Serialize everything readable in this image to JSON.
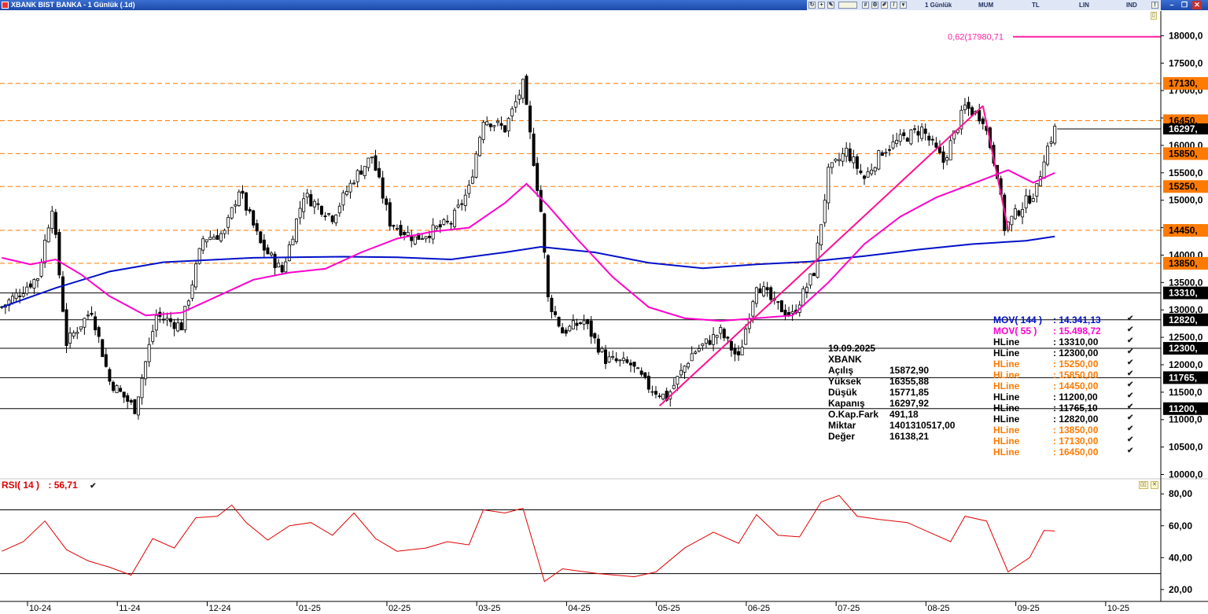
{
  "window": {
    "title": "XBANK BIST BANKA - 1 Günlük (.1d)",
    "toolbar": {
      "period": "1 Günlük",
      "chart_type": "MUM",
      "currency": "TL",
      "scale": "LIN",
      "indicator": "IND"
    }
  },
  "colors": {
    "orange": "#ff7a00",
    "magenta": "#ff00cc",
    "blue": "#0010c8",
    "rsi": "#e00000",
    "fib": "#ff1fa0",
    "trend": "#ff1090"
  },
  "price_axis": {
    "labels": [
      "18000,0",
      "17500,0",
      "17000,0",
      "16500,0",
      "16000,0",
      "15500,0",
      "15000,0",
      "14500,0",
      "14000,0",
      "13500,0",
      "13000,0",
      "12500,0",
      "12000,0",
      "11500,0",
      "11000,0",
      "10500,0",
      "10000,0"
    ],
    "values": [
      18000,
      17500,
      17000,
      16500,
      16000,
      15500,
      15000,
      14500,
      14000,
      13500,
      13000,
      12500,
      12000,
      11500,
      11000,
      10500,
      10000
    ],
    "ylim": [
      9950,
      18450
    ]
  },
  "hlines": [
    {
      "value": 17130,
      "label": "17130,",
      "style": "dashed",
      "color": "#ff7a00"
    },
    {
      "value": 16450,
      "label": "16450,",
      "style": "dashed",
      "color": "#ff7a00"
    },
    {
      "value": 15850,
      "label": "15850,",
      "style": "dashed",
      "color": "#ff7a00"
    },
    {
      "value": 15250,
      "label": "15250,",
      "style": "dashed",
      "color": "#ff7a00"
    },
    {
      "value": 14450,
      "label": "14450,",
      "style": "dashed",
      "color": "#ff7a00"
    },
    {
      "value": 13850,
      "label": "13850,",
      "style": "dashed",
      "color": "#ff7a00"
    },
    {
      "value": 13310,
      "label": "13310,",
      "style": "solid",
      "color": "#000000"
    },
    {
      "value": 12820,
      "label": "12820,",
      "style": "solid",
      "color": "#000000"
    },
    {
      "value": 12300,
      "label": "12300,",
      "style": "solid",
      "color": "#000000"
    },
    {
      "value": 11765,
      "label": "11765,",
      "style": "solid",
      "color": "#000000"
    },
    {
      "value": 11200,
      "label": "11200,",
      "style": "solid",
      "color": "#000000"
    }
  ],
  "current_price_label": "16297,",
  "fib": {
    "label": "0,62(17980,71",
    "value": 17980.71
  },
  "x_axis": {
    "labels": [
      "10-24",
      "11-24",
      "12-24",
      "01-25",
      "02-25",
      "03-25",
      "04-25",
      "05-25",
      "06-25",
      "07-25",
      "08-25",
      "09-25",
      "10-25"
    ],
    "index": [
      10,
      35,
      60,
      85,
      110,
      135,
      160,
      185,
      210,
      235,
      260,
      285,
      310
    ],
    "bars_total": 323
  },
  "info_panel": {
    "date": "19.09.2025",
    "symbol": "XBANK",
    "rows": [
      {
        "k": "Açılış",
        "v": "15872,90"
      },
      {
        "k": "Yüksek",
        "v": "16355,88"
      },
      {
        "k": "Düşük",
        "v": "15771,85"
      },
      {
        "k": "Kapanış",
        "v": "16297,92"
      },
      {
        "k": "O.Kap.Fark",
        "v": "491,18"
      },
      {
        "k": "Miktar",
        "v": "1401310517,00"
      },
      {
        "k": "Değer",
        "v": "16138,21"
      }
    ]
  },
  "legend": [
    {
      "name": "MOV( 144 )",
      "value": ": 14.341,13",
      "color": "#0010c8"
    },
    {
      "name": "MOV( 55 )",
      "value": ": 15.498,72",
      "color": "#ff00cc"
    },
    {
      "name": "HLine",
      "value": ": 13310,00",
      "color": "#000000"
    },
    {
      "name": "HLine",
      "value": ": 12300,00",
      "color": "#000000"
    },
    {
      "name": "HLine",
      "value": ": 15250,00",
      "color": "#ff7a00"
    },
    {
      "name": "HLine",
      "value": ": 15850,00",
      "color": "#ff7a00"
    },
    {
      "name": "HLine",
      "value": ": 14450,00",
      "color": "#ff7a00"
    },
    {
      "name": "HLine",
      "value": ": 11200,00",
      "color": "#000000"
    },
    {
      "name": "HLine",
      "value": ": 11765,10",
      "color": "#000000"
    },
    {
      "name": "HLine",
      "value": ": 12820,00",
      "color": "#000000"
    },
    {
      "name": "HLine",
      "value": ": 13850,00",
      "color": "#ff7a00"
    },
    {
      "name": "HLine",
      "value": ": 17130,00",
      "color": "#ff7a00"
    },
    {
      "name": "HLine",
      "value": ": 16450,00",
      "color": "#ff7a00"
    }
  ],
  "rsi": {
    "label": "RSI( 14 )",
    "value": ": 56,71",
    "axis_labels": [
      "80,00",
      "60,00",
      "40,00",
      "20,00"
    ],
    "axis_values": [
      80,
      60,
      40,
      20
    ],
    "levels": [
      70,
      30
    ],
    "ylim": [
      14,
      88
    ]
  },
  "chart_data": {
    "type": "candlestick",
    "symbol": "XBANK",
    "title": "XBANK BIST BANKA - 1 Günlük (.1d)",
    "ylim": [
      9950,
      18450
    ],
    "anchors": [
      {
        "i": 0,
        "p": 13050
      },
      {
        "i": 10,
        "p": 13600
      },
      {
        "i": 14,
        "p": 14900
      },
      {
        "i": 18,
        "p": 12400
      },
      {
        "i": 25,
        "p": 13000
      },
      {
        "i": 30,
        "p": 11700
      },
      {
        "i": 37,
        "p": 11200
      },
      {
        "i": 43,
        "p": 12900
      },
      {
        "i": 50,
        "p": 12700
      },
      {
        "i": 56,
        "p": 14300
      },
      {
        "i": 62,
        "p": 14400
      },
      {
        "i": 66,
        "p": 15200
      },
      {
        "i": 72,
        "p": 14200
      },
      {
        "i": 78,
        "p": 13700
      },
      {
        "i": 84,
        "p": 15100
      },
      {
        "i": 92,
        "p": 14700
      },
      {
        "i": 98,
        "p": 15400
      },
      {
        "i": 103,
        "p": 15800
      },
      {
        "i": 108,
        "p": 14600
      },
      {
        "i": 115,
        "p": 14300
      },
      {
        "i": 125,
        "p": 14600
      },
      {
        "i": 130,
        "p": 15200
      },
      {
        "i": 134,
        "p": 16500
      },
      {
        "i": 140,
        "p": 16300
      },
      {
        "i": 145,
        "p": 17100
      },
      {
        "i": 150,
        "p": 14800
      },
      {
        "i": 152,
        "p": 13200
      },
      {
        "i": 156,
        "p": 12600
      },
      {
        "i": 162,
        "p": 12800
      },
      {
        "i": 168,
        "p": 12100
      },
      {
        "i": 175,
        "p": 12000
      },
      {
        "i": 180,
        "p": 11600
      },
      {
        "i": 185,
        "p": 11400
      },
      {
        "i": 192,
        "p": 12200
      },
      {
        "i": 200,
        "p": 12600
      },
      {
        "i": 205,
        "p": 12100
      },
      {
        "i": 210,
        "p": 13500
      },
      {
        "i": 215,
        "p": 13100
      },
      {
        "i": 220,
        "p": 12900
      },
      {
        "i": 226,
        "p": 13700
      },
      {
        "i": 230,
        "p": 15500
      },
      {
        "i": 235,
        "p": 15900
      },
      {
        "i": 240,
        "p": 15400
      },
      {
        "i": 245,
        "p": 15900
      },
      {
        "i": 250,
        "p": 16100
      },
      {
        "i": 256,
        "p": 16300
      },
      {
        "i": 262,
        "p": 15700
      },
      {
        "i": 268,
        "p": 16700
      },
      {
        "i": 273,
        "p": 16500
      },
      {
        "i": 277,
        "p": 15500
      },
      {
        "i": 279,
        "p": 14500
      },
      {
        "i": 284,
        "p": 14900
      },
      {
        "i": 288,
        "p": 15200
      },
      {
        "i": 290,
        "p": 15800
      },
      {
        "i": 293,
        "p": 16300
      }
    ],
    "mov144": [
      {
        "i": 0,
        "p": 13050
      },
      {
        "i": 15,
        "p": 13400
      },
      {
        "i": 30,
        "p": 13700
      },
      {
        "i": 45,
        "p": 13870
      },
      {
        "i": 70,
        "p": 13950
      },
      {
        "i": 95,
        "p": 13970
      },
      {
        "i": 110,
        "p": 13960
      },
      {
        "i": 125,
        "p": 13920
      },
      {
        "i": 140,
        "p": 14050
      },
      {
        "i": 150,
        "p": 14150
      },
      {
        "i": 165,
        "p": 14050
      },
      {
        "i": 180,
        "p": 13860
      },
      {
        "i": 195,
        "p": 13760
      },
      {
        "i": 210,
        "p": 13830
      },
      {
        "i": 225,
        "p": 13880
      },
      {
        "i": 240,
        "p": 13980
      },
      {
        "i": 255,
        "p": 14100
      },
      {
        "i": 270,
        "p": 14200
      },
      {
        "i": 285,
        "p": 14260
      },
      {
        "i": 293,
        "p": 14341
      }
    ],
    "mov55": [
      {
        "i": 0,
        "p": 13950
      },
      {
        "i": 8,
        "p": 13830
      },
      {
        "i": 15,
        "p": 13920
      },
      {
        "i": 22,
        "p": 13650
      },
      {
        "i": 30,
        "p": 13250
      },
      {
        "i": 40,
        "p": 12900
      },
      {
        "i": 50,
        "p": 12950
      },
      {
        "i": 60,
        "p": 13250
      },
      {
        "i": 70,
        "p": 13550
      },
      {
        "i": 80,
        "p": 13680
      },
      {
        "i": 90,
        "p": 13750
      },
      {
        "i": 100,
        "p": 14050
      },
      {
        "i": 110,
        "p": 14300
      },
      {
        "i": 120,
        "p": 14430
      },
      {
        "i": 130,
        "p": 14500
      },
      {
        "i": 140,
        "p": 14950
      },
      {
        "i": 146,
        "p": 15300
      },
      {
        "i": 152,
        "p": 14900
      },
      {
        "i": 160,
        "p": 14300
      },
      {
        "i": 170,
        "p": 13600
      },
      {
        "i": 180,
        "p": 13050
      },
      {
        "i": 190,
        "p": 12850
      },
      {
        "i": 200,
        "p": 12800
      },
      {
        "i": 210,
        "p": 12850
      },
      {
        "i": 220,
        "p": 12900
      },
      {
        "i": 230,
        "p": 13500
      },
      {
        "i": 240,
        "p": 14200
      },
      {
        "i": 250,
        "p": 14700
      },
      {
        "i": 260,
        "p": 15050
      },
      {
        "i": 270,
        "p": 15300
      },
      {
        "i": 280,
        "p": 15550
      },
      {
        "i": 287,
        "p": 15320
      },
      {
        "i": 293,
        "p": 15499
      }
    ],
    "trendlines": [
      {
        "from": {
          "i": 183,
          "p": 11250
        },
        "to": {
          "i": 273,
          "p": 16720
        }
      },
      {
        "from": {
          "i": 273,
          "p": 16720
        },
        "to": {
          "i": 280,
          "p": 14480
        }
      }
    ],
    "rsi_series": [
      {
        "i": 0,
        "v": 44
      },
      {
        "i": 6,
        "v": 50
      },
      {
        "i": 12,
        "v": 63
      },
      {
        "i": 18,
        "v": 45
      },
      {
        "i": 24,
        "v": 38
      },
      {
        "i": 30,
        "v": 34
      },
      {
        "i": 36,
        "v": 29
      },
      {
        "i": 42,
        "v": 52
      },
      {
        "i": 48,
        "v": 46
      },
      {
        "i": 54,
        "v": 65
      },
      {
        "i": 60,
        "v": 66
      },
      {
        "i": 64,
        "v": 73
      },
      {
        "i": 68,
        "v": 62
      },
      {
        "i": 74,
        "v": 51
      },
      {
        "i": 80,
        "v": 60
      },
      {
        "i": 86,
        "v": 62
      },
      {
        "i": 92,
        "v": 54
      },
      {
        "i": 98,
        "v": 68
      },
      {
        "i": 104,
        "v": 52
      },
      {
        "i": 110,
        "v": 44
      },
      {
        "i": 118,
        "v": 46
      },
      {
        "i": 124,
        "v": 50
      },
      {
        "i": 130,
        "v": 48
      },
      {
        "i": 134,
        "v": 70
      },
      {
        "i": 140,
        "v": 68
      },
      {
        "i": 145,
        "v": 71
      },
      {
        "i": 148,
        "v": 48
      },
      {
        "i": 151,
        "v": 25
      },
      {
        "i": 156,
        "v": 33
      },
      {
        "i": 166,
        "v": 30
      },
      {
        "i": 176,
        "v": 28
      },
      {
        "i": 182,
        "v": 31
      },
      {
        "i": 190,
        "v": 46
      },
      {
        "i": 198,
        "v": 56
      },
      {
        "i": 205,
        "v": 49
      },
      {
        "i": 210,
        "v": 67
      },
      {
        "i": 216,
        "v": 54
      },
      {
        "i": 222,
        "v": 53
      },
      {
        "i": 228,
        "v": 75
      },
      {
        "i": 233,
        "v": 79
      },
      {
        "i": 238,
        "v": 66
      },
      {
        "i": 244,
        "v": 64
      },
      {
        "i": 252,
        "v": 62
      },
      {
        "i": 258,
        "v": 56
      },
      {
        "i": 264,
        "v": 50
      },
      {
        "i": 268,
        "v": 66
      },
      {
        "i": 274,
        "v": 63
      },
      {
        "i": 280,
        "v": 31
      },
      {
        "i": 286,
        "v": 40
      },
      {
        "i": 290,
        "v": 57
      },
      {
        "i": 293,
        "v": 56.7
      }
    ]
  }
}
